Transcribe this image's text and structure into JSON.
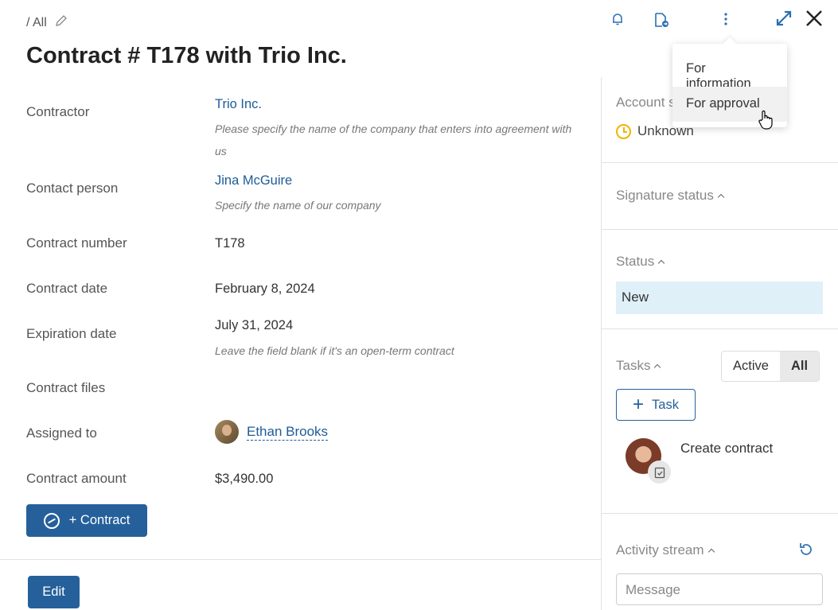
{
  "breadcrumb": {
    "text": "/ All"
  },
  "title": "Contract # T178 with Trio Inc.",
  "fields": {
    "contractor": {
      "label": "Contractor",
      "value": "Trio Inc.",
      "hint": "Please specify the name of the company that enters into agreement with us"
    },
    "contact_person": {
      "label": "Contact person",
      "value": "Jina McGuire",
      "hint": "Specify the name of our company"
    },
    "contract_number": {
      "label": "Contract number",
      "value": "T178"
    },
    "contract_date": {
      "label": "Contract date",
      "value": "February 8, 2024"
    },
    "expiration_date": {
      "label": "Expiration date",
      "value": "July 31, 2024",
      "hint": "Leave the field blank if it's an open-term contract"
    },
    "contract_files": {
      "label": "Contract files"
    },
    "assigned_to": {
      "label": "Assigned to",
      "value": "Ethan Brooks"
    },
    "contract_amount": {
      "label": "Contract amount",
      "value": "$3,490.00"
    }
  },
  "buttons": {
    "add_contract": "+ Contract",
    "edit": "Edit"
  },
  "panel": {
    "account_status": {
      "title": "Account s",
      "value": "Unknown"
    },
    "signature_status": {
      "title": "Signature status"
    },
    "status": {
      "title": "Status",
      "value": "New"
    },
    "tasks": {
      "title": "Tasks",
      "filters": [
        "Active",
        "All"
      ],
      "active_filter": "All",
      "add_label": "Task",
      "items": [
        {
          "name": "Create contract"
        }
      ]
    },
    "activity": {
      "title": "Activity stream",
      "placeholder": "Message"
    }
  },
  "dropdown": {
    "items": [
      "For information",
      "For approval"
    ],
    "hovered": "For approval"
  },
  "icons": [
    "pencil-icon",
    "bell-icon",
    "document-send-icon",
    "more-vertical-icon",
    "expand-icon",
    "close-icon",
    "clock-icon",
    "refresh-icon",
    "checklist-icon"
  ],
  "colors": {
    "accent": "#25609b",
    "link": "#1e5b96",
    "status_bg": "#dff0f8",
    "warning": "#f0b400"
  }
}
